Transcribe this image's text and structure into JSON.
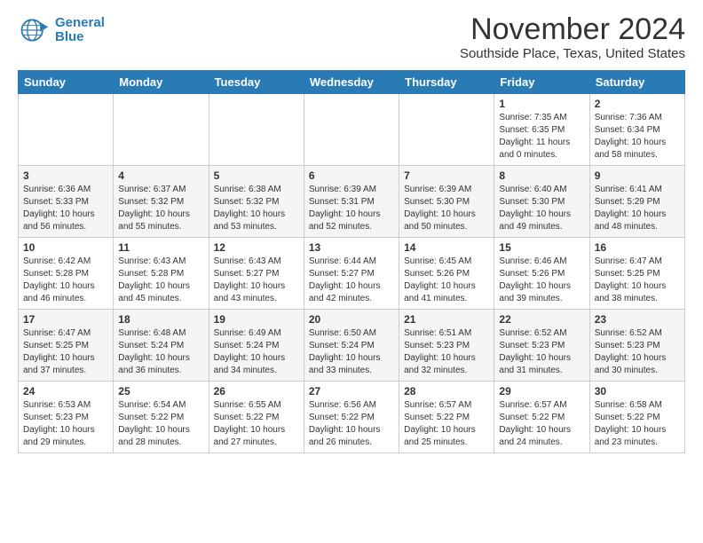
{
  "header": {
    "logo_line1": "General",
    "logo_line2": "Blue",
    "month": "November 2024",
    "location": "Southside Place, Texas, United States"
  },
  "weekdays": [
    "Sunday",
    "Monday",
    "Tuesday",
    "Wednesday",
    "Thursday",
    "Friday",
    "Saturday"
  ],
  "weeks": [
    [
      {
        "day": "",
        "info": ""
      },
      {
        "day": "",
        "info": ""
      },
      {
        "day": "",
        "info": ""
      },
      {
        "day": "",
        "info": ""
      },
      {
        "day": "",
        "info": ""
      },
      {
        "day": "1",
        "info": "Sunrise: 7:35 AM\nSunset: 6:35 PM\nDaylight: 11 hours and 0 minutes."
      },
      {
        "day": "2",
        "info": "Sunrise: 7:36 AM\nSunset: 6:34 PM\nDaylight: 10 hours and 58 minutes."
      }
    ],
    [
      {
        "day": "3",
        "info": "Sunrise: 6:36 AM\nSunset: 5:33 PM\nDaylight: 10 hours and 56 minutes."
      },
      {
        "day": "4",
        "info": "Sunrise: 6:37 AM\nSunset: 5:32 PM\nDaylight: 10 hours and 55 minutes."
      },
      {
        "day": "5",
        "info": "Sunrise: 6:38 AM\nSunset: 5:32 PM\nDaylight: 10 hours and 53 minutes."
      },
      {
        "day": "6",
        "info": "Sunrise: 6:39 AM\nSunset: 5:31 PM\nDaylight: 10 hours and 52 minutes."
      },
      {
        "day": "7",
        "info": "Sunrise: 6:39 AM\nSunset: 5:30 PM\nDaylight: 10 hours and 50 minutes."
      },
      {
        "day": "8",
        "info": "Sunrise: 6:40 AM\nSunset: 5:30 PM\nDaylight: 10 hours and 49 minutes."
      },
      {
        "day": "9",
        "info": "Sunrise: 6:41 AM\nSunset: 5:29 PM\nDaylight: 10 hours and 48 minutes."
      }
    ],
    [
      {
        "day": "10",
        "info": "Sunrise: 6:42 AM\nSunset: 5:28 PM\nDaylight: 10 hours and 46 minutes."
      },
      {
        "day": "11",
        "info": "Sunrise: 6:43 AM\nSunset: 5:28 PM\nDaylight: 10 hours and 45 minutes."
      },
      {
        "day": "12",
        "info": "Sunrise: 6:43 AM\nSunset: 5:27 PM\nDaylight: 10 hours and 43 minutes."
      },
      {
        "day": "13",
        "info": "Sunrise: 6:44 AM\nSunset: 5:27 PM\nDaylight: 10 hours and 42 minutes."
      },
      {
        "day": "14",
        "info": "Sunrise: 6:45 AM\nSunset: 5:26 PM\nDaylight: 10 hours and 41 minutes."
      },
      {
        "day": "15",
        "info": "Sunrise: 6:46 AM\nSunset: 5:26 PM\nDaylight: 10 hours and 39 minutes."
      },
      {
        "day": "16",
        "info": "Sunrise: 6:47 AM\nSunset: 5:25 PM\nDaylight: 10 hours and 38 minutes."
      }
    ],
    [
      {
        "day": "17",
        "info": "Sunrise: 6:47 AM\nSunset: 5:25 PM\nDaylight: 10 hours and 37 minutes."
      },
      {
        "day": "18",
        "info": "Sunrise: 6:48 AM\nSunset: 5:24 PM\nDaylight: 10 hours and 36 minutes."
      },
      {
        "day": "19",
        "info": "Sunrise: 6:49 AM\nSunset: 5:24 PM\nDaylight: 10 hours and 34 minutes."
      },
      {
        "day": "20",
        "info": "Sunrise: 6:50 AM\nSunset: 5:24 PM\nDaylight: 10 hours and 33 minutes."
      },
      {
        "day": "21",
        "info": "Sunrise: 6:51 AM\nSunset: 5:23 PM\nDaylight: 10 hours and 32 minutes."
      },
      {
        "day": "22",
        "info": "Sunrise: 6:52 AM\nSunset: 5:23 PM\nDaylight: 10 hours and 31 minutes."
      },
      {
        "day": "23",
        "info": "Sunrise: 6:52 AM\nSunset: 5:23 PM\nDaylight: 10 hours and 30 minutes."
      }
    ],
    [
      {
        "day": "24",
        "info": "Sunrise: 6:53 AM\nSunset: 5:23 PM\nDaylight: 10 hours and 29 minutes."
      },
      {
        "day": "25",
        "info": "Sunrise: 6:54 AM\nSunset: 5:22 PM\nDaylight: 10 hours and 28 minutes."
      },
      {
        "day": "26",
        "info": "Sunrise: 6:55 AM\nSunset: 5:22 PM\nDaylight: 10 hours and 27 minutes."
      },
      {
        "day": "27",
        "info": "Sunrise: 6:56 AM\nSunset: 5:22 PM\nDaylight: 10 hours and 26 minutes."
      },
      {
        "day": "28",
        "info": "Sunrise: 6:57 AM\nSunset: 5:22 PM\nDaylight: 10 hours and 25 minutes."
      },
      {
        "day": "29",
        "info": "Sunrise: 6:57 AM\nSunset: 5:22 PM\nDaylight: 10 hours and 24 minutes."
      },
      {
        "day": "30",
        "info": "Sunrise: 6:58 AM\nSunset: 5:22 PM\nDaylight: 10 hours and 23 minutes."
      }
    ]
  ]
}
